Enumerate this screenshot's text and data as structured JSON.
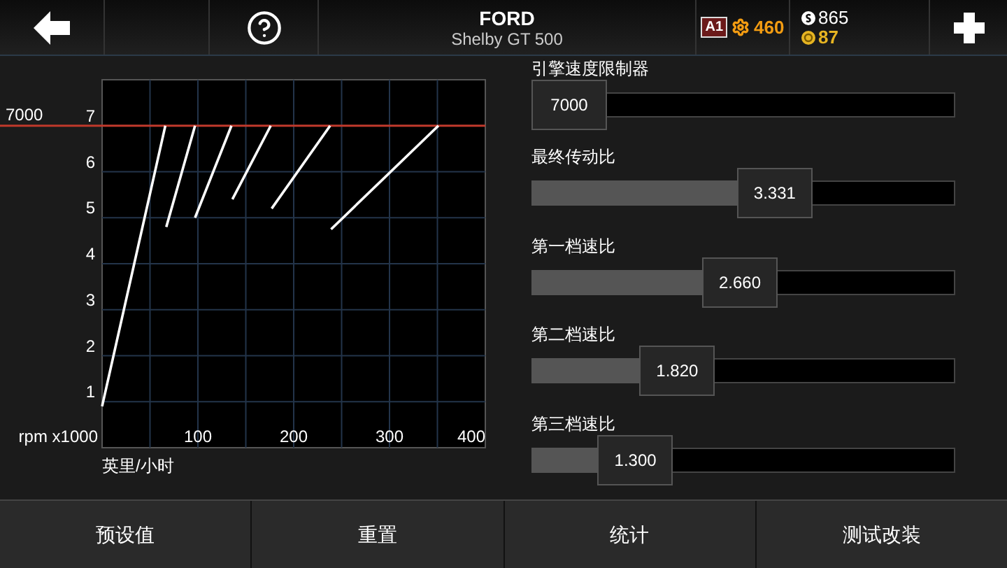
{
  "header": {
    "title": "FORD",
    "subtitle": "Shelby GT 500",
    "class_badge": "A1",
    "performance": "460",
    "cash": "865",
    "gold": "87"
  },
  "chart": {
    "chart_data": {
      "type": "line",
      "xlabel": "英里/小时",
      "ylabel": "rpm x1000",
      "xlim": [
        0,
        400
      ],
      "ylim": [
        0,
        8
      ],
      "xticks": [
        100,
        200,
        300,
        400
      ],
      "yticks": [
        1,
        2,
        3,
        4,
        5,
        6,
        7
      ],
      "grid": true,
      "x": [
        0,
        66,
        67,
        97,
        135,
        136,
        176,
        177,
        238,
        239,
        351
      ],
      "series": [
        {
          "color": "#ffffff",
          "values": [
            0.9,
            7,
            null,
            null,
            null,
            null,
            null,
            null,
            null,
            null,
            null
          ]
        },
        {
          "color": "#ffffff",
          "values": [
            null,
            null,
            4.8,
            7,
            null,
            null,
            null,
            null,
            null,
            null,
            null
          ]
        },
        {
          "color": "#ffffff",
          "values": [
            null,
            null,
            null,
            5.0,
            7,
            null,
            null,
            null,
            null,
            null,
            null
          ]
        },
        {
          "color": "#ffffff",
          "values": [
            null,
            null,
            null,
            null,
            null,
            5.4,
            7,
            null,
            null,
            null,
            null
          ]
        },
        {
          "color": "#ffffff",
          "values": [
            null,
            null,
            null,
            null,
            null,
            null,
            null,
            5.2,
            7,
            null,
            null
          ]
        },
        {
          "color": "#ffffff",
          "values": [
            null,
            null,
            null,
            null,
            null,
            null,
            null,
            null,
            null,
            4.75,
            7
          ]
        }
      ],
      "ref_lines": [
        {
          "axis": "y",
          "value": 7,
          "label": "7000",
          "color": "#c0392b"
        }
      ]
    }
  },
  "sliders": [
    {
      "label": "引擎速度限制器",
      "value": "7000",
      "level": 0
    },
    {
      "label": "最终传动比",
      "value": "3.331",
      "level": 0.59
    },
    {
      "label": "第一档速比",
      "value": "2.660",
      "level": 0.49
    },
    {
      "label": "第二档速比",
      "value": "1.820",
      "level": 0.31
    },
    {
      "label": "第三档速比",
      "value": "1.300",
      "level": 0.19
    }
  ],
  "footer_buttons": [
    "预设值",
    "重置",
    "统计",
    "测试改装"
  ]
}
